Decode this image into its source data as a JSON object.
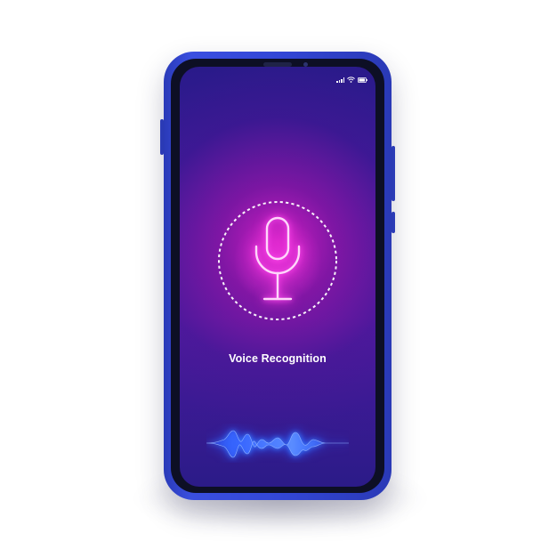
{
  "app": {
    "title": "Voice Recognition"
  },
  "status_bar": {
    "icons": [
      "signal-icon",
      "wifi-icon",
      "battery-icon"
    ]
  },
  "main": {
    "mic_button_icon": "microphone-icon",
    "waveform_icon": "audio-waveform-icon"
  },
  "colors": {
    "frame": "#3347d6",
    "screen_top": "#2a1a8a",
    "glow": "#e61ec8",
    "mic_stroke": "#ffd6fb",
    "wave_glow": "#3a7cff",
    "text": "#ffffff"
  }
}
